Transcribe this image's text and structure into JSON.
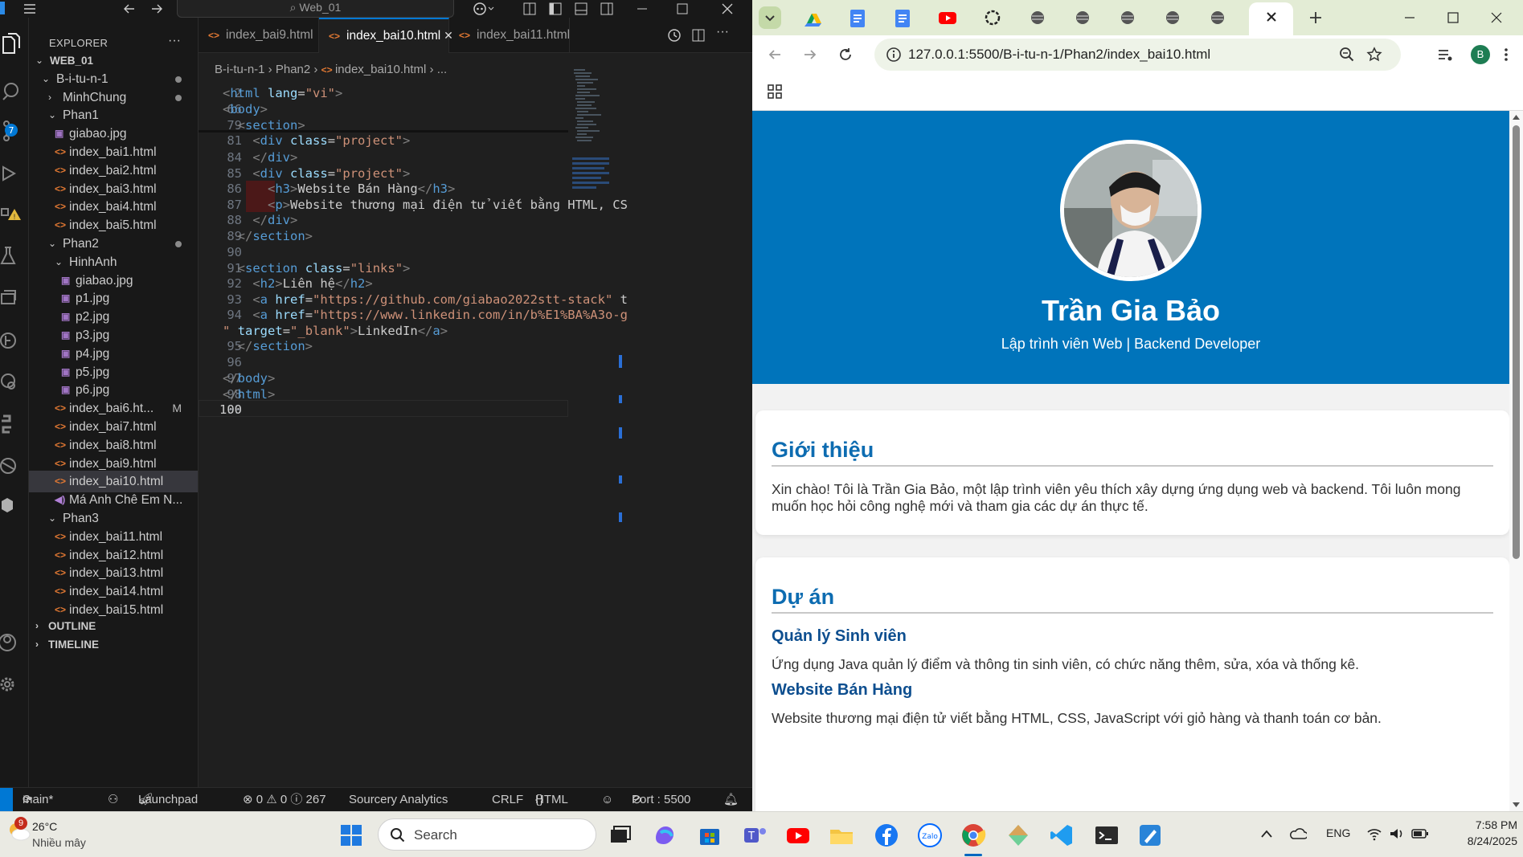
{
  "vscode": {
    "search_text": "Web_01",
    "explorer_title": "EXPLORER",
    "explorer_more": "···",
    "tree": [
      {
        "label": "WEB_01",
        "kind": "root"
      },
      {
        "label": "B-i-tu-n-1",
        "kind": "folder-open",
        "dot": true
      },
      {
        "label": "MinhChung",
        "kind": "folder-closed",
        "dot": true
      },
      {
        "label": "Phan1",
        "kind": "folder-open"
      },
      {
        "label": "giabao.jpg",
        "kind": "image"
      },
      {
        "label": "index_bai1.html",
        "kind": "html"
      },
      {
        "label": "index_bai2.html",
        "kind": "html"
      },
      {
        "label": "index_bai3.html",
        "kind": "html"
      },
      {
        "label": "index_bai4.html",
        "kind": "html"
      },
      {
        "label": "index_bai5.html",
        "kind": "html"
      },
      {
        "label": "Phan2",
        "kind": "folder-open",
        "dot": true
      },
      {
        "label": "HinhAnh",
        "kind": "folder-open"
      },
      {
        "label": "giabao.jpg",
        "kind": "image"
      },
      {
        "label": "p1.jpg",
        "kind": "image"
      },
      {
        "label": "p2.jpg",
        "kind": "image"
      },
      {
        "label": "p3.jpg",
        "kind": "image"
      },
      {
        "label": "p4.jpg",
        "kind": "image"
      },
      {
        "label": "p5.jpg",
        "kind": "image"
      },
      {
        "label": "p6.jpg",
        "kind": "image"
      },
      {
        "label": "index_bai6.ht...",
        "kind": "html",
        "mod": "M"
      },
      {
        "label": "index_bai7.html",
        "kind": "html"
      },
      {
        "label": "index_bai8.html",
        "kind": "html"
      },
      {
        "label": "index_bai9.html",
        "kind": "html"
      },
      {
        "label": "index_bai10.html",
        "kind": "html",
        "selected": true
      },
      {
        "label": "Má Anh Chê Em N...",
        "kind": "audio"
      },
      {
        "label": "Phan3",
        "kind": "folder-open"
      },
      {
        "label": "index_bai11.html",
        "kind": "html"
      },
      {
        "label": "index_bai12.html",
        "kind": "html"
      },
      {
        "label": "index_bai13.html",
        "kind": "html"
      },
      {
        "label": "index_bai14.html",
        "kind": "html"
      },
      {
        "label": "index_bai15.html",
        "kind": "html"
      }
    ],
    "outline_label": "OUTLINE",
    "timeline_label": "TIMELINE",
    "tabs": [
      {
        "label": "index_bai9.html",
        "active": false
      },
      {
        "label": "index_bai10.html",
        "active": true
      },
      {
        "label": "index_bai11.html",
        "active": false
      }
    ],
    "breadcrumb": [
      "B-i-tu-n-1",
      "Phan2",
      "index_bai10.html",
      "..."
    ],
    "code_lines": [
      {
        "n": "2",
        "tokens": [
          [
            "br",
            "<"
          ],
          [
            "tag",
            "html"
          ],
          [
            "txt",
            " "
          ],
          [
            "attr",
            "lang"
          ],
          [
            "txt",
            "="
          ],
          [
            "str",
            "\"vi\""
          ],
          [
            "br",
            ">"
          ]
        ]
      },
      {
        "n": "66",
        "tokens": [
          [
            "br",
            "<"
          ],
          [
            "tag",
            "body"
          ],
          [
            "br",
            ">"
          ]
        ]
      },
      {
        "n": "79",
        "tokens": [
          [
            "txt",
            "  "
          ],
          [
            "br",
            "<"
          ],
          [
            "tag",
            "section"
          ],
          [
            "br",
            ">"
          ]
        ]
      },
      {
        "n": "81",
        "tokens": [
          [
            "txt",
            "    "
          ],
          [
            "br",
            "<"
          ],
          [
            "tag",
            "div"
          ],
          [
            "txt",
            " "
          ],
          [
            "attr",
            "class"
          ],
          [
            "txt",
            "="
          ],
          [
            "str",
            "\"project\""
          ],
          [
            "br",
            ">"
          ]
        ]
      },
      {
        "n": "84",
        "tokens": [
          [
            "txt",
            "    "
          ],
          [
            "br",
            "</"
          ],
          [
            "tag",
            "div"
          ],
          [
            "br",
            ">"
          ]
        ]
      },
      {
        "n": "85",
        "tokens": [
          [
            "txt",
            "    "
          ],
          [
            "br",
            "<"
          ],
          [
            "tag",
            "div"
          ],
          [
            "txt",
            " "
          ],
          [
            "attr",
            "class"
          ],
          [
            "txt",
            "="
          ],
          [
            "str",
            "\"project\""
          ],
          [
            "br",
            ">"
          ]
        ]
      },
      {
        "n": "86",
        "tokens": [
          [
            "txt",
            "      "
          ],
          [
            "br",
            "<"
          ],
          [
            "tag",
            "h3"
          ],
          [
            "br",
            ">"
          ],
          [
            "txt",
            "Website Bán Hàng"
          ],
          [
            "br",
            "</"
          ],
          [
            "tag",
            "h3"
          ],
          [
            "br",
            ">"
          ]
        ]
      },
      {
        "n": "87",
        "tokens": [
          [
            "txt",
            "      "
          ],
          [
            "br",
            "<"
          ],
          [
            "tag",
            "p"
          ],
          [
            "br",
            ">"
          ],
          [
            "txt",
            "Website thương mại điện tử viết bằng HTML, CS"
          ]
        ]
      },
      {
        "n": "88",
        "tokens": [
          [
            "txt",
            "    "
          ],
          [
            "br",
            "</"
          ],
          [
            "tag",
            "div"
          ],
          [
            "br",
            ">"
          ]
        ]
      },
      {
        "n": "89",
        "tokens": [
          [
            "txt",
            "  "
          ],
          [
            "br",
            "</"
          ],
          [
            "tag",
            "section"
          ],
          [
            "br",
            ">"
          ]
        ]
      },
      {
        "n": "90",
        "tokens": []
      },
      {
        "n": "91",
        "tokens": [
          [
            "txt",
            "  "
          ],
          [
            "br",
            "<"
          ],
          [
            "tag",
            "section"
          ],
          [
            "txt",
            " "
          ],
          [
            "attr",
            "class"
          ],
          [
            "txt",
            "="
          ],
          [
            "str",
            "\"links\""
          ],
          [
            "br",
            ">"
          ]
        ]
      },
      {
        "n": "92",
        "tokens": [
          [
            "txt",
            "    "
          ],
          [
            "br",
            "<"
          ],
          [
            "tag",
            "h2"
          ],
          [
            "br",
            ">"
          ],
          [
            "txt",
            "Liên hệ"
          ],
          [
            "br",
            "</"
          ],
          [
            "tag",
            "h2"
          ],
          [
            "br",
            ">"
          ]
        ]
      },
      {
        "n": "93",
        "tokens": [
          [
            "txt",
            "    "
          ],
          [
            "br",
            "<"
          ],
          [
            "tag",
            "a"
          ],
          [
            "txt",
            " "
          ],
          [
            "attr",
            "href"
          ],
          [
            "txt",
            "="
          ],
          [
            "str",
            "\"https://github.com/giabao2022stt-stack\""
          ],
          [
            "txt",
            " t"
          ]
        ]
      },
      {
        "n": "94",
        "tokens": [
          [
            "txt",
            "    "
          ],
          [
            "br",
            "<"
          ],
          [
            "tag",
            "a"
          ],
          [
            "txt",
            " "
          ],
          [
            "attr",
            "href"
          ],
          [
            "txt",
            "="
          ],
          [
            "str",
            "\"https://www.linkedin.com/in/b%E1%BA%A3o-g"
          ]
        ]
      },
      {
        "n": "",
        "tokens": [
          [
            "str",
            "\""
          ],
          [
            "txt",
            " "
          ],
          [
            "attr",
            "target"
          ],
          [
            "txt",
            "="
          ],
          [
            "str",
            "\"_blank\""
          ],
          [
            "br",
            ">"
          ],
          [
            "txt",
            "LinkedIn"
          ],
          [
            "br",
            "</"
          ],
          [
            "tag",
            "a"
          ],
          [
            "br",
            ">"
          ]
        ]
      },
      {
        "n": "95",
        "tokens": [
          [
            "txt",
            "  "
          ],
          [
            "br",
            "</"
          ],
          [
            "tag",
            "section"
          ],
          [
            "br",
            ">"
          ]
        ]
      },
      {
        "n": "96",
        "tokens": []
      },
      {
        "n": "97",
        "tokens": [
          [
            "br",
            "</"
          ],
          [
            "tag",
            "body"
          ],
          [
            "br",
            ">"
          ]
        ]
      },
      {
        "n": "98",
        "tokens": [
          [
            "br",
            "</"
          ],
          [
            "tag",
            "html"
          ],
          [
            "br",
            ">"
          ]
        ]
      },
      {
        "n": "99",
        "tokens": []
      },
      {
        "n": "100",
        "tokens": [],
        "current": true
      }
    ],
    "status": {
      "branch": "main*",
      "launchpad": "Launchpad",
      "problems": "⊗ 0 ⚠ 0 ⓘ 267",
      "sourcery": "Sourcery Analytics",
      "eol": "CRLF",
      "language": "HTML",
      "port": "Port : 5500"
    },
    "badge_count": "7"
  },
  "chrome": {
    "url": "127.0.0.1:5500/B-i-tu-n-1/Phan2/index_bai10.html",
    "profile_initial": "B"
  },
  "page": {
    "name": "Trần Gia Bảo",
    "role": "Lập trình viên Web | Backend Developer",
    "intro": {
      "title": "Giới thiệu",
      "text": "Xin chào! Tôi là Trần Gia Bảo, một lập trình viên yêu thích xây dựng ứng dụng web và backend. Tôi luôn mong muốn học hỏi công nghệ mới và tham gia các dự án thực tế."
    },
    "projects": {
      "title": "Dự án",
      "items": [
        {
          "title": "Quản lý Sinh viên",
          "desc": "Ứng dụng Java quản lý điểm và thông tin sinh viên, có chức năng thêm, sửa, xóa và thống kê."
        },
        {
          "title": "Website Bán Hàng",
          "desc": "Website thương mại điện tử viết bằng HTML, CSS, JavaScript với giỏ hàng và thanh toán cơ bản."
        }
      ]
    }
  },
  "taskbar": {
    "weather_temp": "26°C",
    "weather_desc": "Nhiều mây",
    "weather_badge": "9",
    "search_label": "Search",
    "lang": "ENG",
    "time": "7:58 PM",
    "date": "8/24/2025"
  },
  "colors": {
    "hero_bg": "#0074bb",
    "heading_blue": "#0d6cb1",
    "vscode_accent": "#0078d4"
  }
}
